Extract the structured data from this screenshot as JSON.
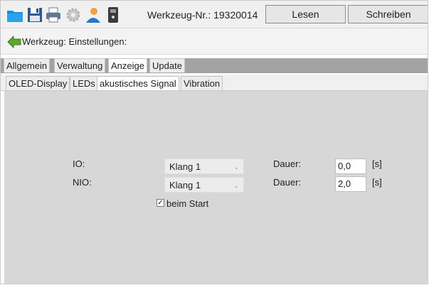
{
  "toolbar": {
    "icons": [
      "folder-icon",
      "save-icon",
      "print-icon",
      "settings-gear-icon",
      "user-icon",
      "device-icon"
    ],
    "tool_number": "Werkzeug-Nr.: 19320014",
    "read_button": "Lesen",
    "write_button": "Schreiben"
  },
  "header": {
    "back_icon": "arrow-left-icon",
    "title": "Werkzeug: Einstellungen:"
  },
  "tabs_main": [
    "Allgemein",
    "Verwaltung",
    "Anzeige",
    "Update"
  ],
  "tabs_main_active": "Anzeige",
  "tabs_sub": [
    "OLED-Display",
    "LEDs",
    "akustisches Signal",
    "Vibration"
  ],
  "tabs_sub_active": "akustisches Signal",
  "form": {
    "rows": [
      {
        "label": "IO:",
        "sound": "Klang 1",
        "duration_label": "Dauer:",
        "duration": "0,0",
        "unit": "[s]"
      },
      {
        "label": "NIO:",
        "sound": "Klang 1",
        "duration_label": "Dauer:",
        "duration": "2,0",
        "unit": "[s]"
      }
    ],
    "checkbox_label": "beim Start",
    "checkbox_checked": true
  },
  "colors": {
    "main_tab_bar": "#a3a3a3",
    "content_bg": "#d7d7d7",
    "back_arrow": "#5aa832"
  }
}
